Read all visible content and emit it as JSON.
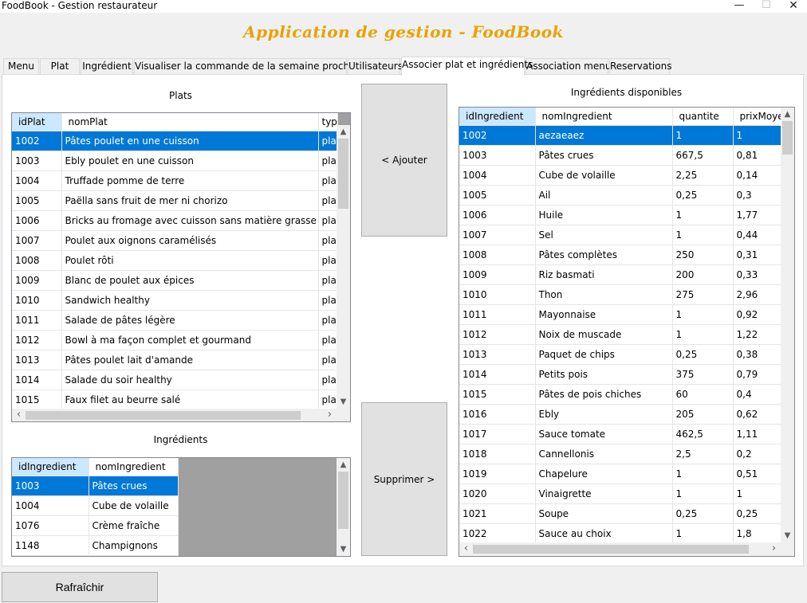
{
  "window": {
    "title": "FoodBook - Gestion restaurateur",
    "minimize": "—",
    "maximize": "☐",
    "close": "✕"
  },
  "app_title": "Application de gestion - FoodBook",
  "tabs": [
    {
      "label": "Menu"
    },
    {
      "label": "Plat"
    },
    {
      "label": "Ingrédient"
    },
    {
      "label": "Visualiser la commande de la semaine prochaine"
    },
    {
      "label": "Utilisateurs"
    },
    {
      "label": "Associer plat et ingrédients"
    },
    {
      "label": "Association menu"
    },
    {
      "label": "Reservations"
    }
  ],
  "active_tab": "Associer plat et ingrédients",
  "plats": {
    "caption": "Plats",
    "columns": [
      "idPlat",
      "nomPlat",
      "typ"
    ],
    "rows": [
      [
        "1002",
        "Pâtes poulet en une cuisson",
        "plat"
      ],
      [
        "1003",
        "Ebly poulet en une cuisson",
        "plat"
      ],
      [
        "1004",
        "Truffade pomme de terre",
        "plat"
      ],
      [
        "1005",
        "Paëlla sans fruit de mer ni chorizo",
        "plat"
      ],
      [
        "1006",
        "Bricks au fromage avec cuisson sans matière grasse",
        "plat"
      ],
      [
        "1007",
        "Poulet aux oignons caramélisés",
        "plat"
      ],
      [
        "1008",
        "Poulet rôti",
        "plat"
      ],
      [
        "1009",
        "Blanc de poulet aux épices",
        "plat"
      ],
      [
        "1010",
        "Sandwich healthy",
        "plat"
      ],
      [
        "1011",
        "Salade de pâtes légère",
        "plat"
      ],
      [
        "1012",
        "Bowl à ma façon complet et gourmand",
        "plat"
      ],
      [
        "1013",
        "Pâtes poulet lait d'amande",
        "plat"
      ],
      [
        "1014",
        "Salade du soir healthy",
        "plat"
      ],
      [
        "1015",
        "Faux filet au beurre salé",
        "plat"
      ]
    ],
    "selected_row": 0
  },
  "ingredients_plat": {
    "caption": "Ingrédients",
    "columns": [
      "idIngredient",
      "nomIngredient"
    ],
    "rows": [
      [
        "1003",
        "Pâtes crues"
      ],
      [
        "1004",
        "Cube de volaille"
      ],
      [
        "1076",
        "Crème fraîche"
      ],
      [
        "1148",
        "Champignons"
      ]
    ],
    "selected_row": 0
  },
  "buttons": {
    "ajouter": "< Ajouter",
    "supprimer": "Supprimer >",
    "rafraichir": "Rafraîchir"
  },
  "ingredients_disponibles": {
    "caption": "Ingrédients disponibles",
    "columns": [
      "idIngredient",
      "nomIngredient",
      "quantite",
      "prixMoyer"
    ],
    "rows": [
      [
        "1002",
        "aezaeaez",
        "1",
        "1"
      ],
      [
        "1003",
        "Pâtes crues",
        "667,5",
        "0,81"
      ],
      [
        "1004",
        "Cube de volaille",
        "2,25",
        "0,14"
      ],
      [
        "1005",
        "Ail",
        "0,25",
        "0,3"
      ],
      [
        "1006",
        "Huile",
        "1",
        "1,77"
      ],
      [
        "1007",
        "Sel",
        "1",
        "0,44"
      ],
      [
        "1008",
        "Pâtes complètes",
        "250",
        "0,31"
      ],
      [
        "1009",
        "Riz basmati",
        "200",
        "0,33"
      ],
      [
        "1010",
        "Thon",
        "275",
        "2,96"
      ],
      [
        "1011",
        "Mayonnaise",
        "1",
        "0,92"
      ],
      [
        "1012",
        "Noix de muscade",
        "1",
        "1,22"
      ],
      [
        "1013",
        "Paquet de chips",
        "0,25",
        "0,38"
      ],
      [
        "1014",
        "Petits pois",
        "375",
        "0,79"
      ],
      [
        "1015",
        "Pâtes de pois chiches",
        "60",
        "0,4"
      ],
      [
        "1016",
        "Ebly",
        "205",
        "0,62"
      ],
      [
        "1017",
        "Sauce tomate",
        "462,5",
        "1,11"
      ],
      [
        "1018",
        "Cannellonis",
        "2,5",
        "0,2"
      ],
      [
        "1019",
        "Chapelure",
        "1",
        "0,51"
      ],
      [
        "1020",
        "Vinaigrette",
        "1",
        "1"
      ],
      [
        "1021",
        "Soupe",
        "0,25",
        "0,25"
      ],
      [
        "1022",
        "Sauce au choix",
        "1",
        "1,8"
      ]
    ],
    "selected_row": 0
  },
  "scroll_arrows": {
    "up": "▲",
    "down": "▼",
    "left": "‹",
    "right": "›"
  },
  "colors": {
    "title_accent": "#e8a200",
    "selection": "#0078d7",
    "header_selected": "#cce8ff"
  }
}
